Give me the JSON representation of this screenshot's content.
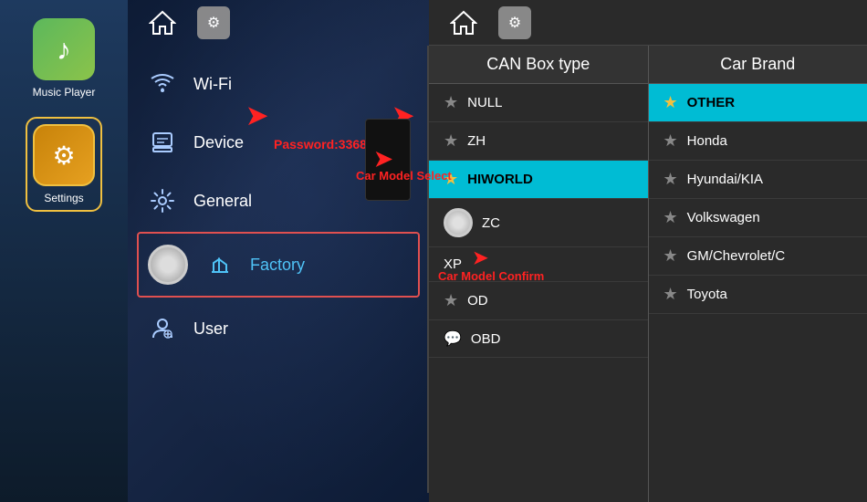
{
  "sidebar": {
    "apps": [
      {
        "id": "music-player",
        "label": "Music Player",
        "icon": "♪",
        "bg_class": "music-icon-bg"
      },
      {
        "id": "settings",
        "label": "Settings",
        "icon": "⚙",
        "bg_class": "settings-icon-bg"
      }
    ]
  },
  "main_panel": {
    "menu_items": [
      {
        "id": "wifi",
        "icon": "wifi",
        "label": "Wi-Fi",
        "active": false
      },
      {
        "id": "device",
        "icon": "device",
        "label": "Device",
        "active": false
      },
      {
        "id": "general",
        "icon": "gear",
        "label": "General",
        "active": false
      },
      {
        "id": "factory",
        "icon": "wrench",
        "label": "Factory",
        "active": true
      },
      {
        "id": "user",
        "icon": "user",
        "label": "User",
        "active": false
      }
    ],
    "password_label": "Password:3368",
    "car_model_select_label": "Car Model Select",
    "car_model_confirm_label": "Car Model Confirm"
  },
  "can_box": {
    "header": "CAN Box type",
    "items": [
      {
        "id": "null",
        "label": "NULL",
        "star": false,
        "selected": false
      },
      {
        "id": "zh",
        "label": "ZH",
        "star": false,
        "selected": false
      },
      {
        "id": "hiworld",
        "label": "HIWORLD",
        "star": true,
        "selected": true
      },
      {
        "id": "zc",
        "label": "ZC",
        "star": false,
        "selected": false,
        "toggle": true
      },
      {
        "id": "xp",
        "label": "XP",
        "star": false,
        "selected": false
      },
      {
        "id": "od",
        "label": "OD",
        "star": false,
        "selected": false
      },
      {
        "id": "obd",
        "label": "OBD",
        "star": false,
        "selected": false,
        "icon": "circle"
      }
    ]
  },
  "car_brand": {
    "header": "Car Brand",
    "items": [
      {
        "id": "other",
        "label": "OTHER",
        "star": true,
        "selected": true
      },
      {
        "id": "honda",
        "label": "Honda",
        "star": false
      },
      {
        "id": "hyundai",
        "label": "Hyundai/KIA",
        "star": false
      },
      {
        "id": "volkswagen",
        "label": "Volkswagen",
        "star": false
      },
      {
        "id": "gm",
        "label": "GM/Chevrolet/C",
        "star": false
      },
      {
        "id": "toyota",
        "label": "Toyota",
        "star": false
      }
    ]
  },
  "icons": {
    "home": "⌂",
    "settings": "⚙",
    "wifi": "📶",
    "gear": "⚙",
    "wrench": "🔧",
    "user": "👤",
    "device": "📋",
    "star_gold": "★",
    "star_empty": "★",
    "arrow_right": "➤"
  }
}
